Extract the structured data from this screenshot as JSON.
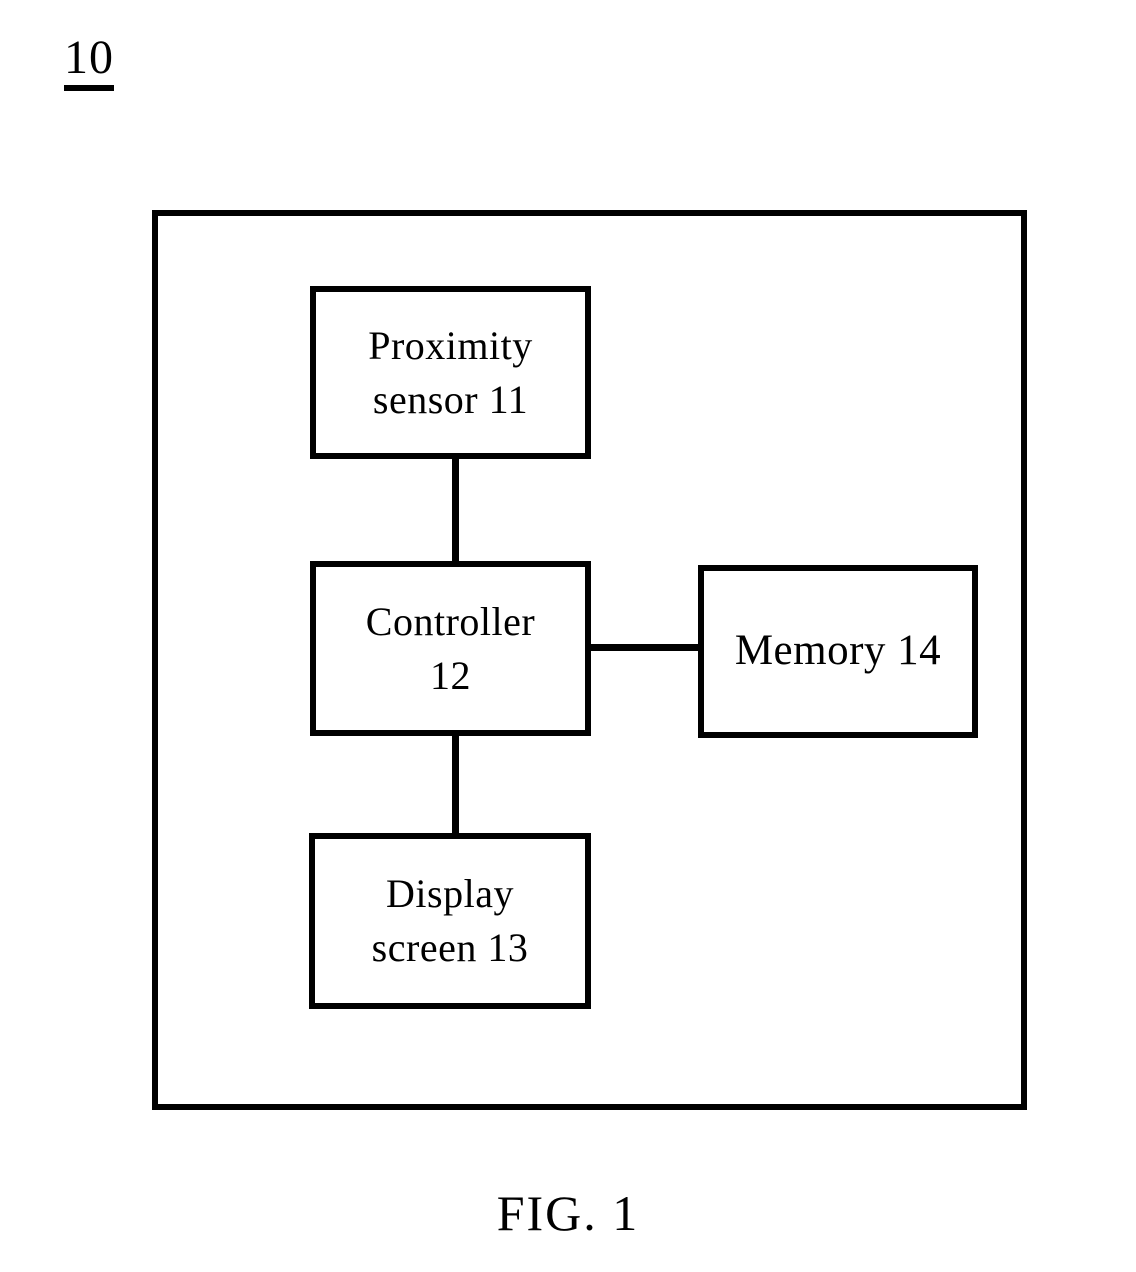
{
  "figure": {
    "reference_numeral": "10",
    "caption": "FIG. 1",
    "line_color": "#000000",
    "background_color": "#ffffff"
  },
  "diagram": {
    "type": "block-diagram",
    "enclosure_label": "10",
    "blocks": [
      {
        "id": "proximity-sensor",
        "label": "Proximity\nsensor 11",
        "numeral": "11"
      },
      {
        "id": "controller",
        "label": "Controller\n12",
        "numeral": "12"
      },
      {
        "id": "memory",
        "label": "Memory 14",
        "numeral": "14"
      },
      {
        "id": "display-screen",
        "label": "Display\nscreen 13",
        "numeral": "13"
      }
    ],
    "connections": [
      {
        "from": "proximity-sensor",
        "to": "controller",
        "orientation": "vertical"
      },
      {
        "from": "controller",
        "to": "display-screen",
        "orientation": "vertical"
      },
      {
        "from": "controller",
        "to": "memory",
        "orientation": "horizontal"
      }
    ]
  }
}
